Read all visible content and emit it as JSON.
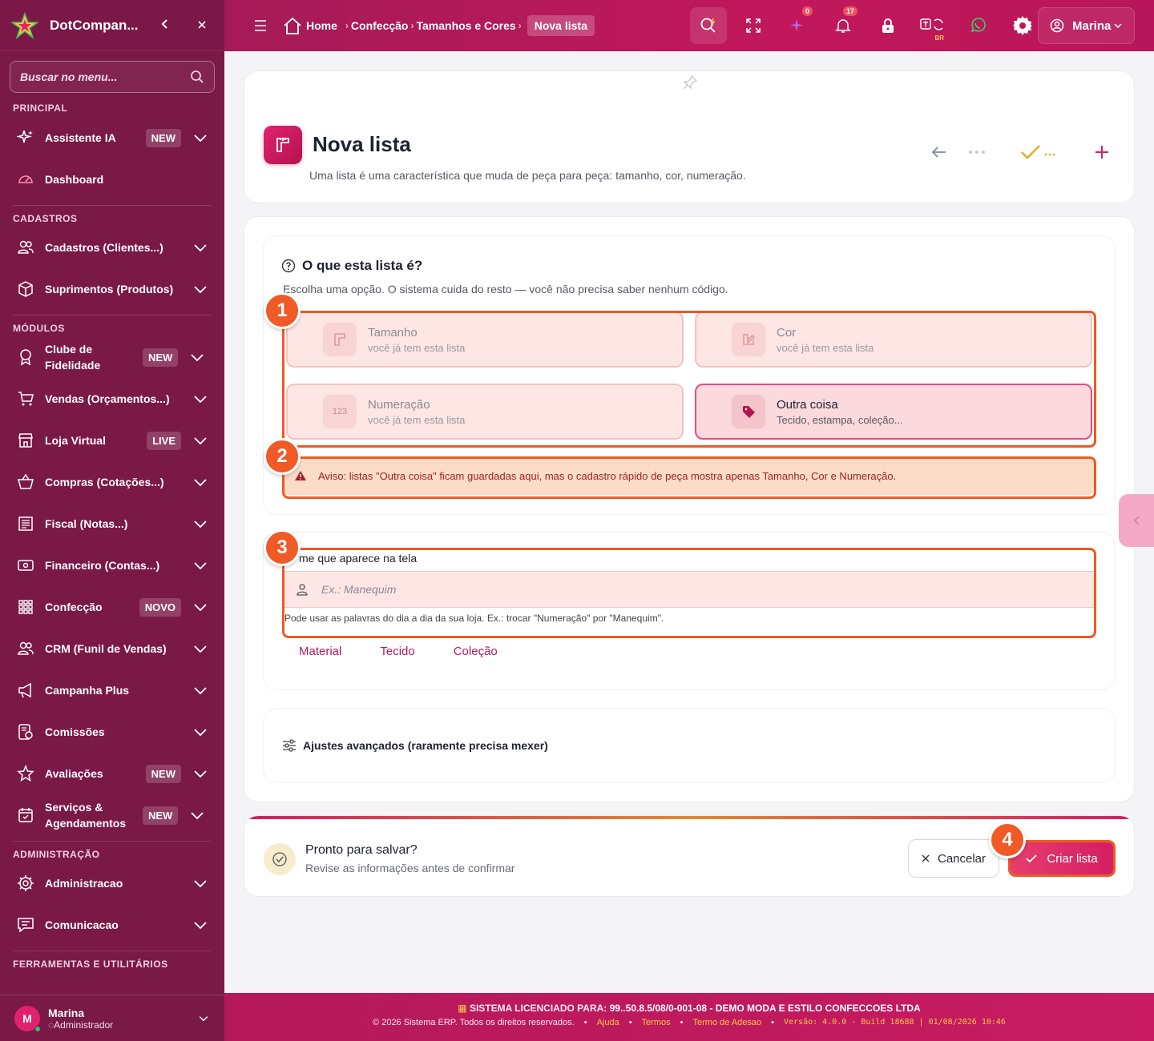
{
  "app": {
    "brand": "DotCompan...",
    "search_placeholder": "Buscar no menu..."
  },
  "sidebar": {
    "sections": {
      "principal": "PRINCIPAL",
      "cadastros": "CADASTROS",
      "modulos": "MÓDULOS",
      "administracao": "ADMINISTRAÇÃO",
      "ferramentas": "FERRAMENTAS E UTILITÁRIOS"
    },
    "items": [
      {
        "label": "Assistente IA",
        "badge": "NEW",
        "icon": "sparkles-icon"
      },
      {
        "label": "Dashboard",
        "badge": "",
        "icon": "gauge-icon"
      },
      {
        "label": "Cadastros (Clientes...)",
        "badge": "",
        "icon": "users-icon"
      },
      {
        "label": "Suprimentos (Produtos)",
        "badge": "",
        "icon": "box-icon"
      },
      {
        "label": "Clube de Fidelidade",
        "badge": "NEW",
        "icon": "award-icon"
      },
      {
        "label": "Vendas (Orçamentos...)",
        "badge": "",
        "icon": "cart-icon"
      },
      {
        "label": "Loja Virtual",
        "badge": "LIVE",
        "icon": "store-icon"
      },
      {
        "label": "Compras (Cotações...)",
        "badge": "",
        "icon": "basket-icon"
      },
      {
        "label": "Fiscal (Notas...)",
        "badge": "",
        "icon": "receipt-icon"
      },
      {
        "label": "Financeiro (Contas...)",
        "badge": "",
        "icon": "cash-icon"
      },
      {
        "label": "Confecção",
        "badge": "NOVO",
        "icon": "grid-icon"
      },
      {
        "label": "CRM (Funil de Vendas)",
        "badge": "",
        "icon": "users-icon"
      },
      {
        "label": "Campanha Plus",
        "badge": "",
        "icon": "megaphone-icon"
      },
      {
        "label": "Comissões",
        "badge": "",
        "icon": "commission-icon"
      },
      {
        "label": "Avaliações",
        "badge": "NEW",
        "icon": "star-icon"
      },
      {
        "label": "Serviços & Agendamentos",
        "badge": "NEW",
        "icon": "calendar-icon"
      },
      {
        "label": "Administracao",
        "badge": "",
        "icon": "gear-icon"
      },
      {
        "label": "Comunicacao",
        "badge": "",
        "icon": "message-icon"
      }
    ],
    "user": {
      "name": "Marina",
      "role": "Administrador",
      "initial": "M"
    }
  },
  "topbar": {
    "breadcrumb": [
      "Home",
      "Confecção",
      "Tamanhos e Cores"
    ],
    "current": "Nova lista",
    "badges": {
      "ai": "0",
      "notifications": "17"
    },
    "lang": "BR",
    "user": "Marina"
  },
  "header": {
    "title": "Nova lista",
    "subtitle": "Uma lista é uma característica que muda de peça para peça: tamanho, cor, numeração."
  },
  "question": {
    "title": "O que esta lista é?",
    "subtitle": "Escolha uma opção. O sistema cuida do resto — você não precisa saber nenhum código.",
    "options": [
      {
        "title": "Tamanho",
        "desc": "você já tem esta lista",
        "selected": false
      },
      {
        "title": "Cor",
        "desc": "você já tem esta lista",
        "selected": false
      },
      {
        "title": "Numeração",
        "desc": "você já tem esta lista",
        "selected": false,
        "icon_text": "123"
      },
      {
        "title": "Outra coisa",
        "desc": "Tecido, estampa, coleção...",
        "selected": true
      }
    ],
    "warning": "Aviso: listas \"Outra coisa\" ficam guardadas aqui, mas o cadastro rápido de peça mostra apenas Tamanho, Cor e Numeração."
  },
  "name_field": {
    "label": "me que aparece na tela",
    "placeholder": "Ex.: Manequim",
    "help": "Pode usar as palavras do dia a dia da sua loja. Ex.: trocar \"Numeração\" por \"Manequim\".",
    "suggestions": [
      "Material",
      "Tecido",
      "Coleção"
    ]
  },
  "advanced": {
    "label": "Ajustes avançados (raramente precisa mexer)"
  },
  "save": {
    "title": "Pronto para salvar?",
    "subtitle": "Revise as informações antes de confirmar",
    "cancel": "Cancelar",
    "create": "Criar lista"
  },
  "annotations": [
    "1",
    "2",
    "3",
    "4"
  ],
  "footer": {
    "license_prefix": "SISTEMA LICENCIADO PARA:",
    "license": "99..50.8.5/08/0-001-08 - DEMO MODA E ESTILO CONFECCOES LTDA",
    "copyright": "© 2026 Sistema ERP. Todos os direitos reservados.",
    "links": [
      "Ajuda",
      "Termos",
      "Termo de Adesao"
    ],
    "version": "Versão: 4.0.0 - Build 18688 | 01/08/2026 10:46"
  },
  "colors": {
    "primary": "#c2185b",
    "sidebar": "#7a1846",
    "highlight": "#ee5a24",
    "gold": "#e0b030"
  }
}
